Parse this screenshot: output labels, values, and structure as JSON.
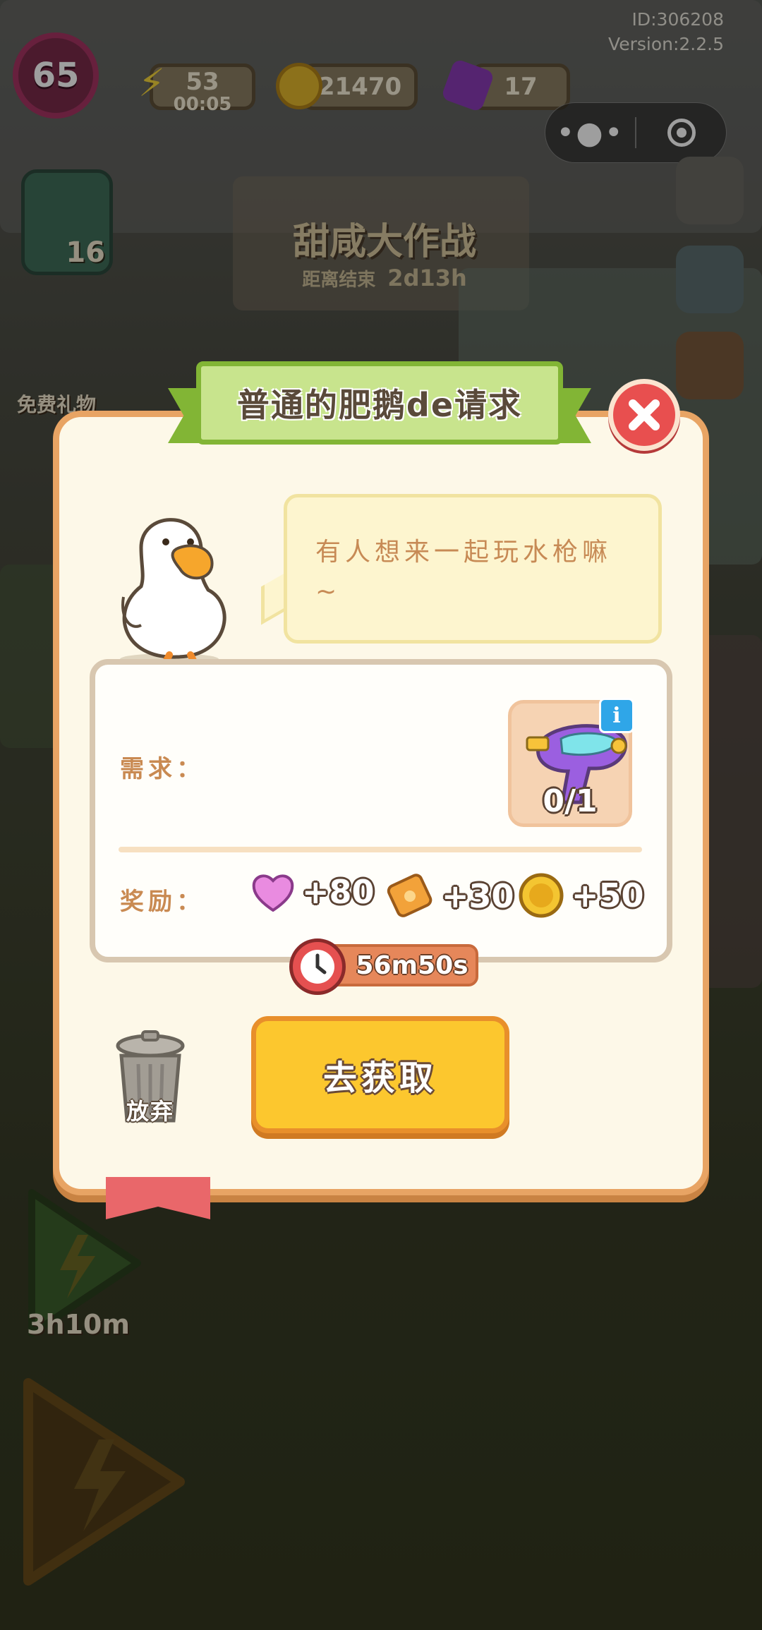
{
  "hud": {
    "level": "65",
    "energy": "53",
    "energy_timer": "00:05",
    "coins": "21470",
    "gems": "17",
    "account_id": "ID:306208",
    "version": "Version:2.2.5"
  },
  "background": {
    "event_title": "甜咸大作战",
    "event_subtitle": "距离结束",
    "event_timer": "2d13h",
    "free_gift": "免费礼物",
    "clover_count": "16",
    "energy_timer_bottom": "3h10m"
  },
  "dialog": {
    "title": "普通的肥鹅de请求",
    "speech": "有人想来一起玩水枪嘛~",
    "demand_label": "需求：",
    "item_name": "water-gun",
    "item_progress": "0/1",
    "item_info": "i",
    "reward_label": "奖励：",
    "rewards": [
      {
        "icon": "heart-icon",
        "value": "+80"
      },
      {
        "icon": "ticket-icon",
        "value": "+30"
      },
      {
        "icon": "coin-icon",
        "value": "+50"
      }
    ],
    "timer": "56m50s",
    "abandon_label": "放弃",
    "go_button": "去获取"
  },
  "colors": {
    "modal_bg": "#fdf8e8",
    "modal_border": "#e8a464",
    "banner_green": "#c8e48d",
    "close_red": "#e84f4f",
    "go_button_yellow": "#fcc72e",
    "label_brown": "#c98a52"
  }
}
